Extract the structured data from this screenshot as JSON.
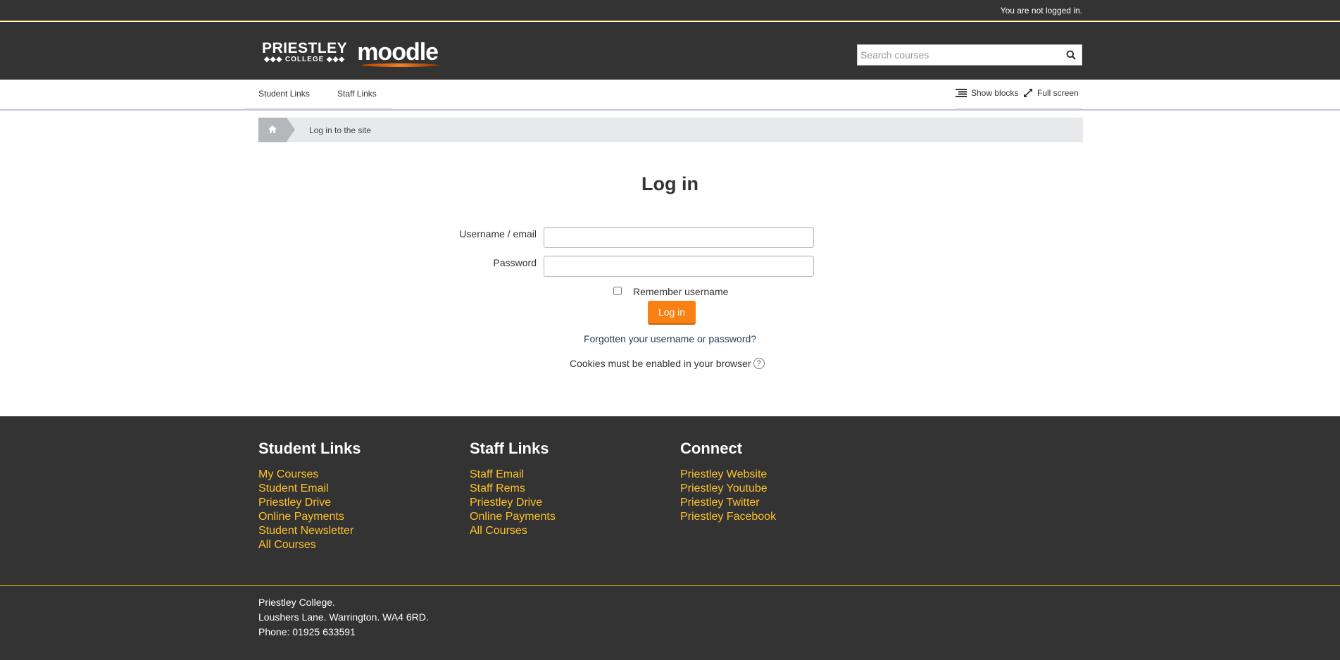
{
  "topbar": {
    "login_info": "You are not logged in."
  },
  "header": {
    "logo_priestley": "PRIESTLEY",
    "logo_college": "◆◆◆ COLLEGE ◆◆◆",
    "logo_moodle": "moodle",
    "search_placeholder": "Search courses"
  },
  "nav": {
    "items": [
      {
        "label": "Student Links"
      },
      {
        "label": "Staff Links"
      }
    ],
    "show_blocks": "Show blocks",
    "full_screen": "Full screen"
  },
  "breadcrumb": {
    "current": "Log in to the site"
  },
  "login": {
    "title": "Log in",
    "username_label": "Username / email",
    "username_value": "",
    "password_label": "Password",
    "password_value": "",
    "remember_label": "Remember username",
    "remember_checked": false,
    "submit_label": "Log in",
    "forgot_link": "Forgotten your username or password?",
    "cookies_notice": "Cookies must be enabled in your browser"
  },
  "footer": {
    "columns": [
      {
        "heading": "Student Links",
        "links": [
          "My Courses",
          "Student Email",
          "Priestley Drive",
          "Online Payments",
          "Student Newsletter",
          "All Courses"
        ]
      },
      {
        "heading": "Staff Links",
        "links": [
          "Staff Email",
          "Staff Rems",
          "Priestley Drive",
          "Online Payments",
          "All Courses"
        ]
      },
      {
        "heading": "Connect",
        "links": [
          "Priestley Website",
          "Priestley Youtube",
          "Priestley Twitter",
          "Priestley Facebook"
        ]
      }
    ],
    "address": [
      "Priestley College.",
      "Loushers Lane. Warrington. WA4 6RD.",
      "Phone: 01925 633591"
    ]
  },
  "colors": {
    "dark_bg": "#333333",
    "accent_orange": "#f98012",
    "link_yellow": "#fbc02d",
    "gold_rule": "#d4a80a"
  }
}
